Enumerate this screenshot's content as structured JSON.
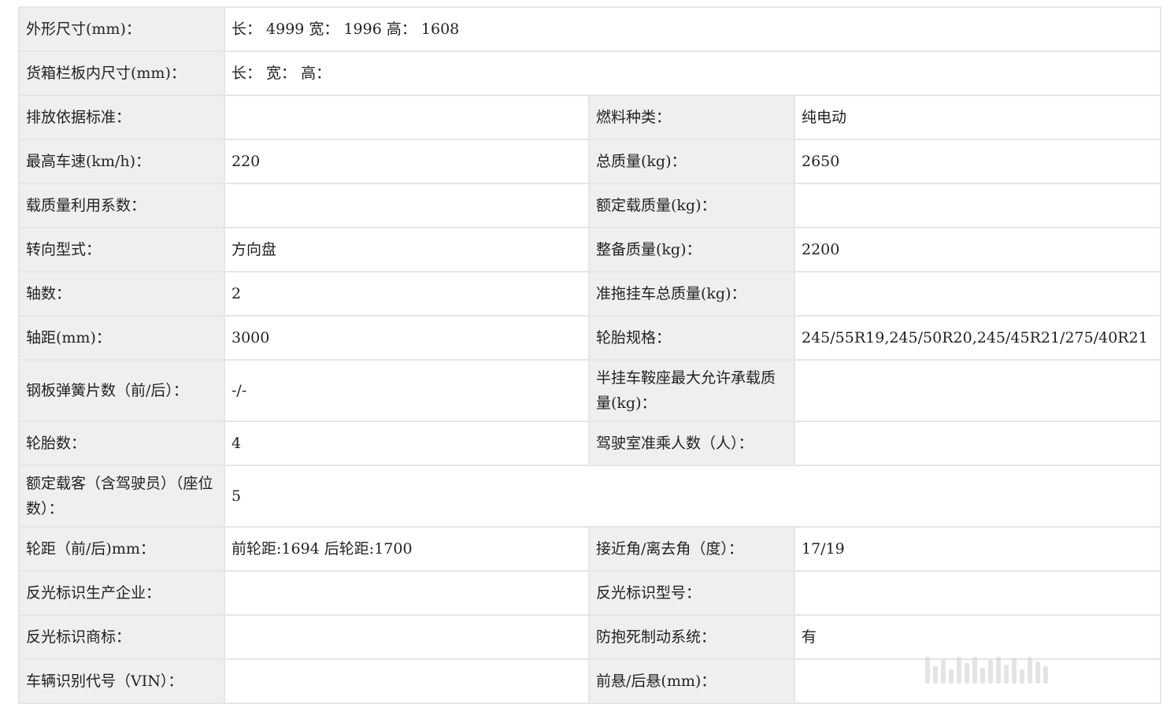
{
  "rows": [
    {
      "type": "wide",
      "label": "外形尺寸(mm)：",
      "value": "长： 4999 宽： 1996 高： 1608"
    },
    {
      "type": "wide",
      "label": "货箱栏板内尺寸(mm)：",
      "value": "长：  宽：  高："
    },
    {
      "type": "pair",
      "l1": "排放依据标准：",
      "v1": "",
      "l2": "燃料种类：",
      "v2": "纯电动"
    },
    {
      "type": "pair",
      "l1": "最高车速(km/h)：",
      "v1": "220",
      "l2": "总质量(kg)：",
      "v2": "2650"
    },
    {
      "type": "pair",
      "l1": "载质量利用系数：",
      "v1": "",
      "l2": "额定载质量(kg)：",
      "v2": ""
    },
    {
      "type": "pair",
      "l1": "转向型式：",
      "v1": "方向盘",
      "l2": "整备质量(kg)：",
      "v2": "2200"
    },
    {
      "type": "pair",
      "l1": "轴数：",
      "v1": "2",
      "l2": "准拖挂车总质量(kg)：",
      "v2": ""
    },
    {
      "type": "pair",
      "l1": "轴距(mm)：",
      "v1": "3000",
      "l2": "轮胎规格：",
      "v2": "245/55R19,245/50R20,245/45R21/275/40R21"
    },
    {
      "type": "pair",
      "l1": "钢板弹簧片数（前/后）：",
      "v1": "-/-",
      "l2": "半挂车鞍座最大允许承载质量(kg)：",
      "v2": ""
    },
    {
      "type": "pair",
      "l1": "轮胎数：",
      "v1": "4",
      "l2": "驾驶室准乘人数（人）：",
      "v2": ""
    },
    {
      "type": "wide",
      "label": "额定载客（含驾驶员）（座位数）：",
      "value": "5"
    },
    {
      "type": "pair",
      "l1": "轮距（前/后)mm：",
      "v1": "前轮距:1694 后轮距:1700",
      "l2": "接近角/离去角（度）：",
      "v2": "17/19"
    },
    {
      "type": "pair",
      "l1": "反光标识生产企业：",
      "v1": "",
      "l2": "反光标识型号：",
      "v2": ""
    },
    {
      "type": "pair",
      "l1": "反光标识商标：",
      "v1": "",
      "l2": "防抱死制动系统：",
      "v2": "有"
    },
    {
      "type": "pair",
      "l1": "车辆识别代号（VIN）：",
      "v1": "",
      "l2": "前悬/后悬(mm)：",
      "v2": ""
    }
  ]
}
